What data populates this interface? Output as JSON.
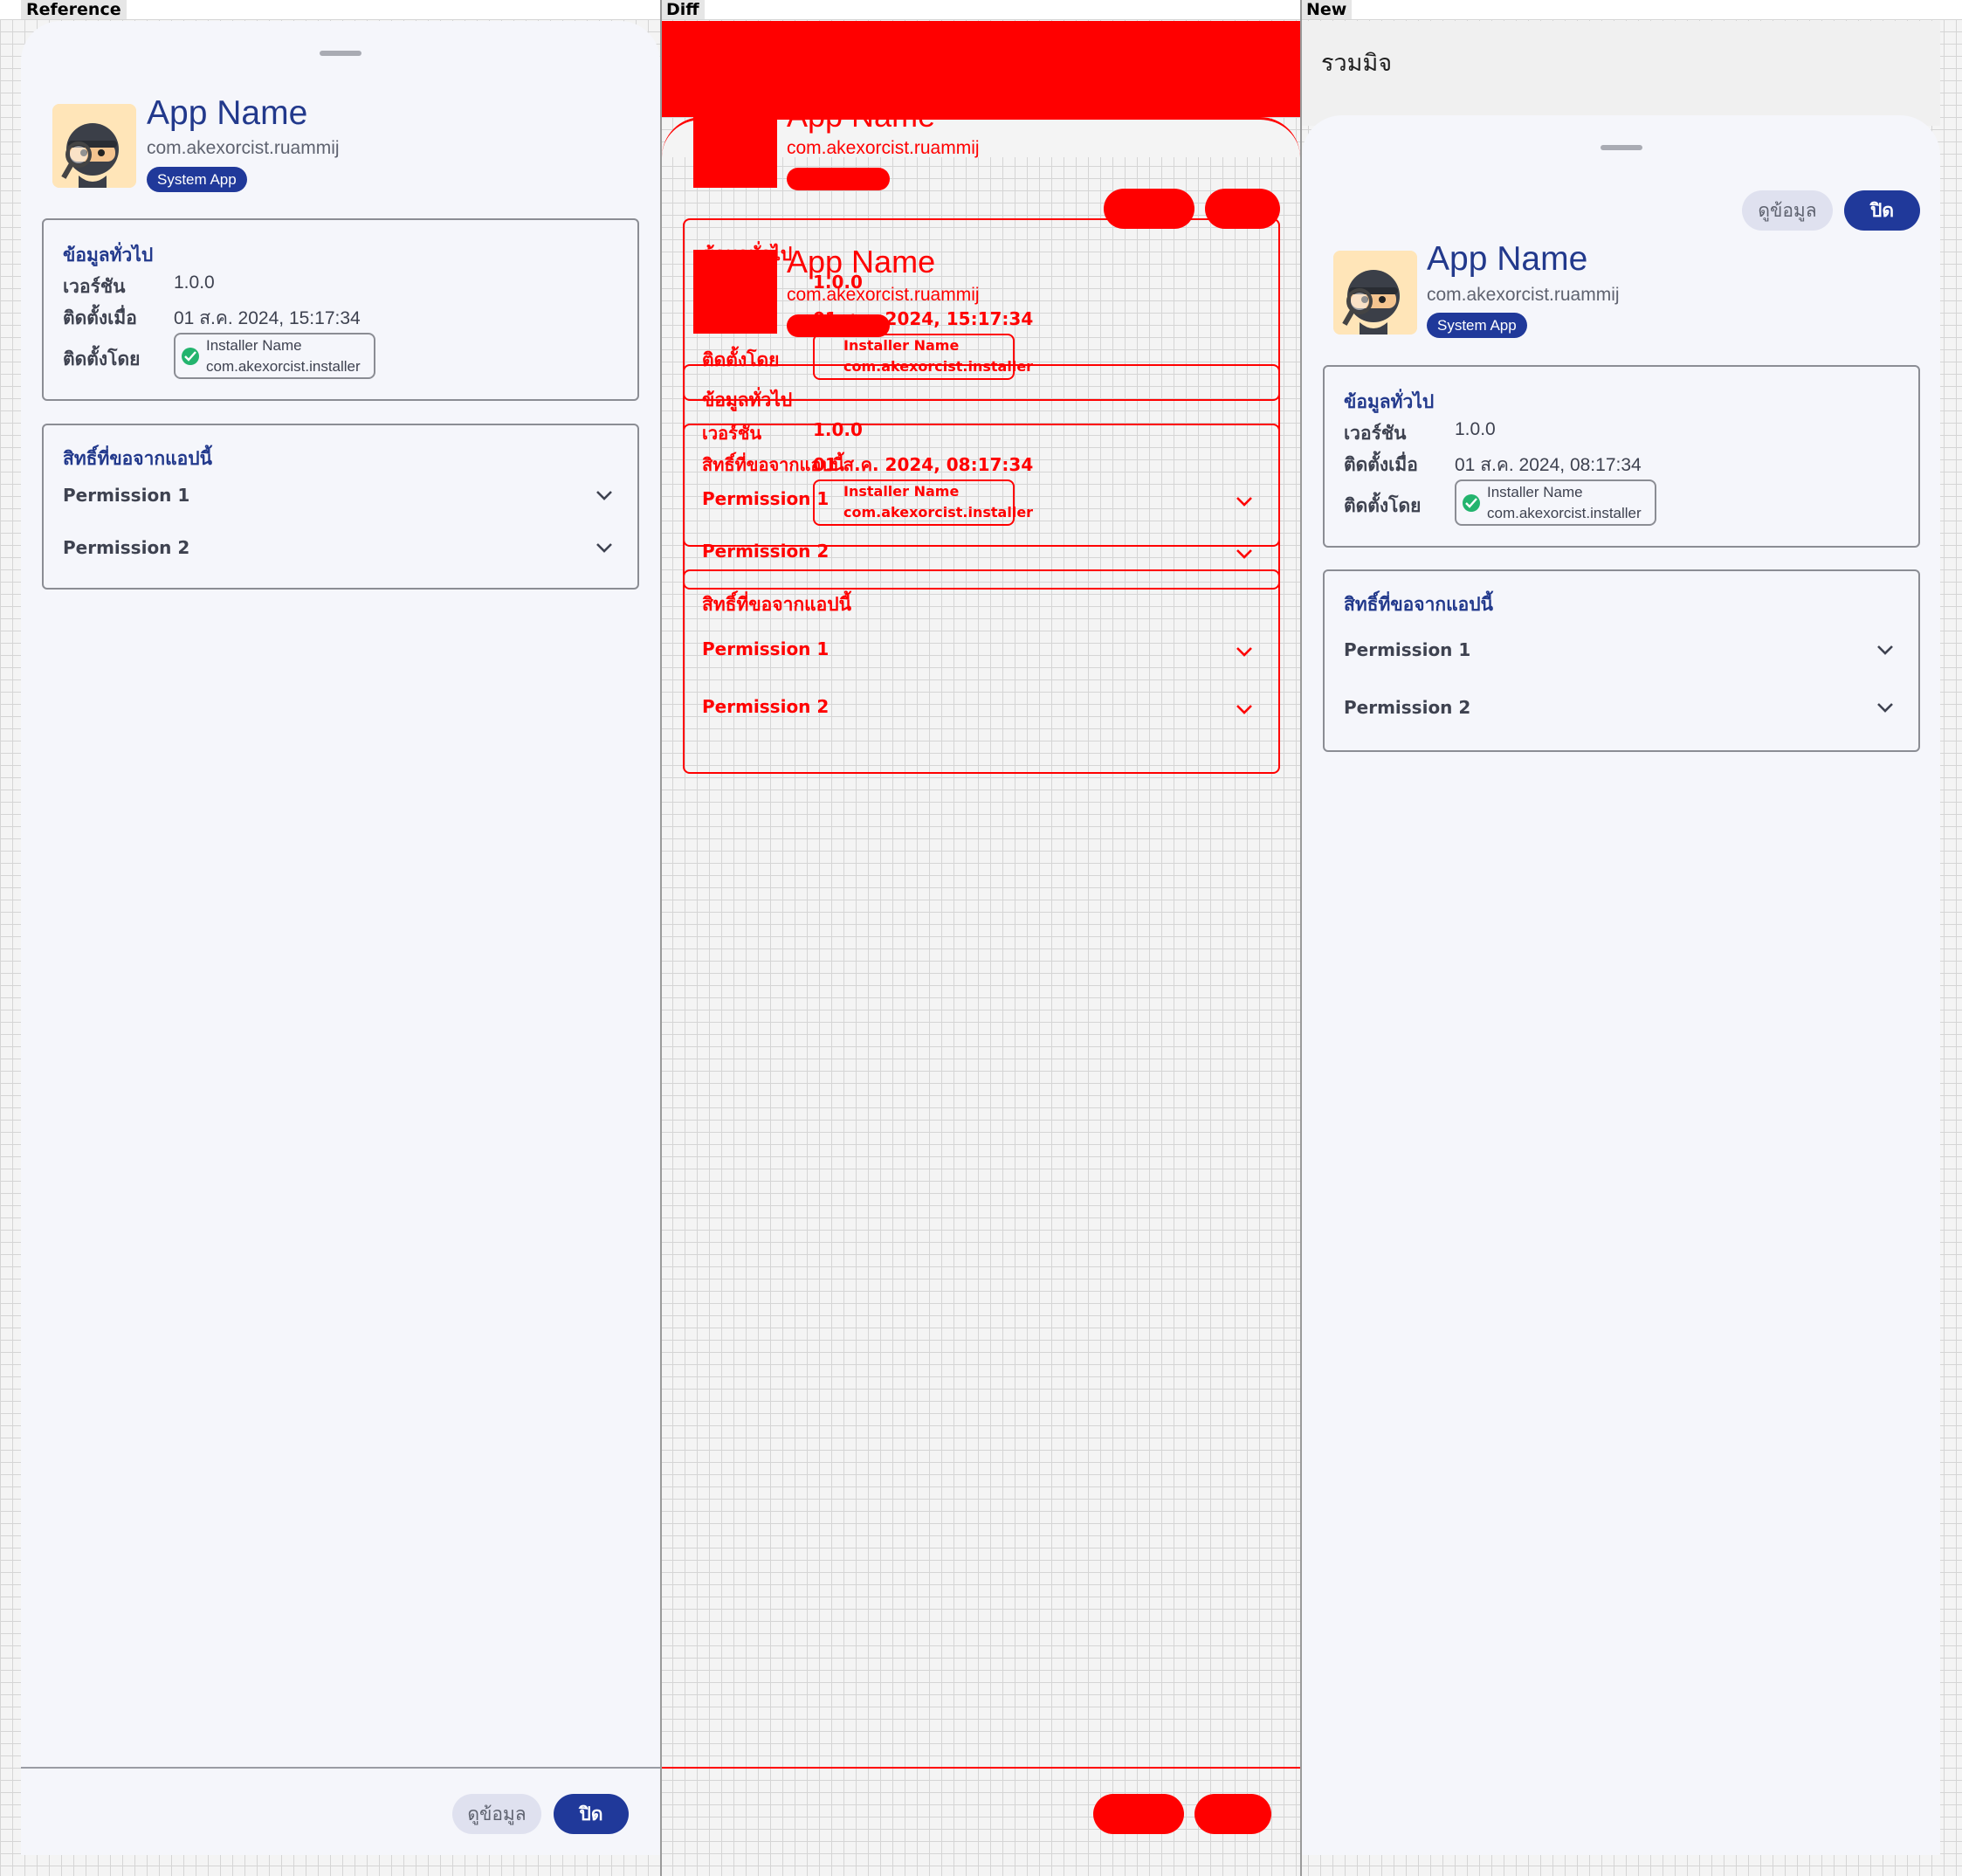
{
  "panels": {
    "reference_label": "Reference",
    "diff_label": "Diff",
    "new_label": "New"
  },
  "app": {
    "window_title": "รวมมิจ",
    "name": "App Name",
    "package": "com.akexorcist.ruammij",
    "badge": "System App",
    "icon": "ninja-detective-icon"
  },
  "general": {
    "title": "ข้อมูลทั่วไป",
    "version_label": "เวอร์ชัน",
    "version_value": "1.0.0",
    "installed_at_label": "ติดตั้งเมื่อ",
    "installed_at_value_reference": "01 ส.ค. 2024, 15:17:34",
    "installed_at_value_new": "01 ส.ค. 2024, 08:17:34",
    "installed_by_label": "ติดตั้งโดย",
    "installer_name": "Installer Name",
    "installer_package": "com.akexorcist.installer"
  },
  "permissions": {
    "title": "สิทธิ์ที่ขอจากแอปนี้",
    "items": [
      {
        "label": "Permission 1"
      },
      {
        "label": "Permission 2"
      }
    ]
  },
  "actions": {
    "details_label": "ดูข้อมูล",
    "close_label": "ปิด"
  },
  "colors": {
    "accent": "#20399a",
    "title_text": "#22398c",
    "success": "#23b46e",
    "diff": "#ff0000"
  }
}
